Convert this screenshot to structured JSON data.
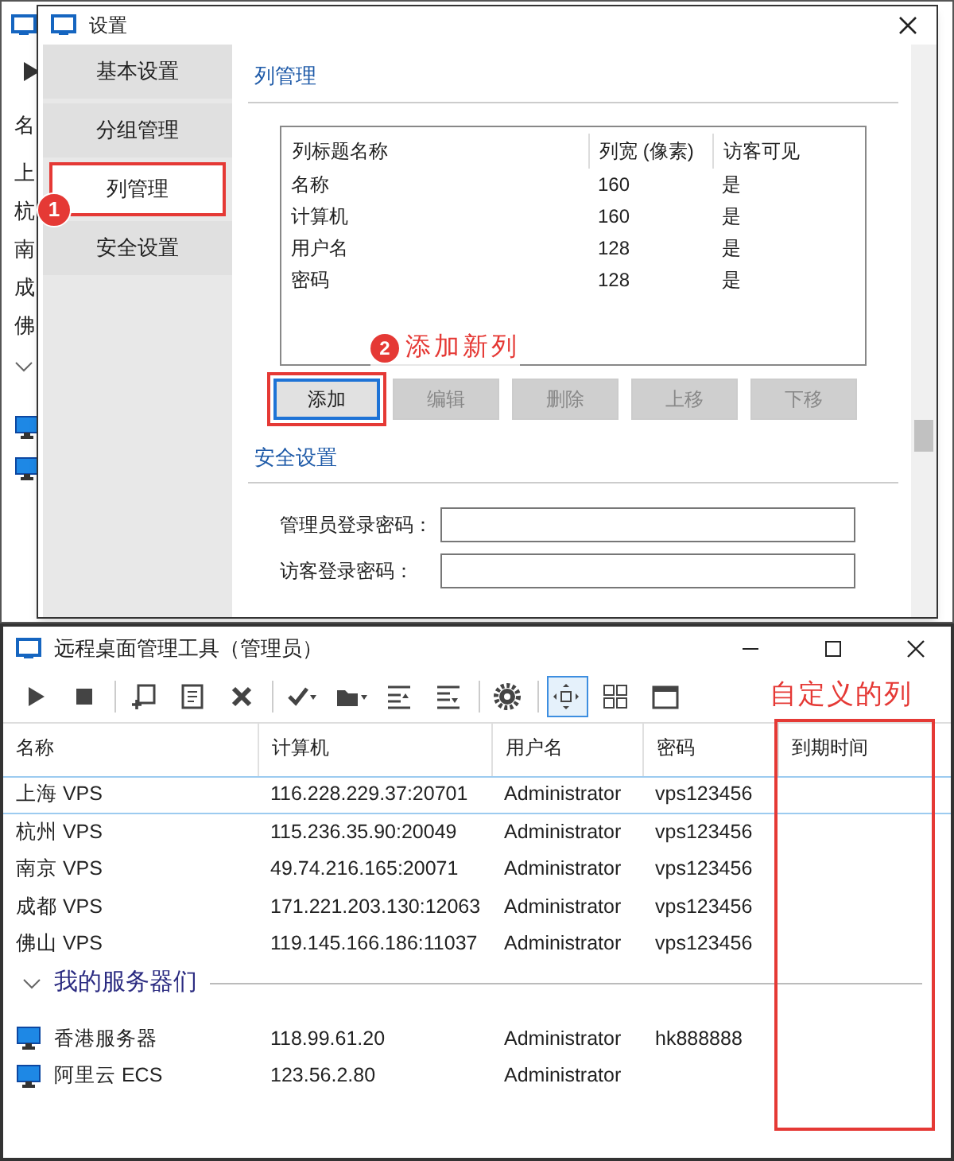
{
  "background_window": {
    "column_header": "名",
    "row_labels": [
      "上",
      "杭",
      "南",
      "成",
      "佛"
    ]
  },
  "settings_dialog": {
    "title": "设置",
    "nav": [
      {
        "label": "基本设置",
        "selected": false
      },
      {
        "label": "分组管理",
        "selected": false
      },
      {
        "label": "列管理",
        "selected": true
      },
      {
        "label": "安全设置",
        "selected": false
      }
    ],
    "column_section": {
      "title": "列管理",
      "columns": [
        "列标题名称",
        "列宽 (像素)",
        "访客可见"
      ],
      "rows": [
        [
          "名称",
          "160",
          "是"
        ],
        [
          "计算机",
          "160",
          "是"
        ],
        [
          "用户名",
          "128",
          "是"
        ],
        [
          "密码",
          "128",
          "是"
        ]
      ]
    },
    "buttons": [
      {
        "label": "添加",
        "disabled": false
      },
      {
        "label": "编辑",
        "disabled": true
      },
      {
        "label": "删除",
        "disabled": true
      },
      {
        "label": "上移",
        "disabled": true
      },
      {
        "label": "下移",
        "disabled": true
      }
    ],
    "security_section": {
      "title": "安全设置",
      "fields": [
        {
          "label": "管理员登录密码："
        },
        {
          "label": "访客登录密码："
        }
      ]
    }
  },
  "annotations": [
    {
      "number": "1"
    },
    {
      "number": "2",
      "text": "添加新列"
    },
    {
      "text": "自定义的列"
    }
  ],
  "main_window": {
    "title": "远程桌面管理工具（管理员）",
    "toolbar": [
      {
        "kind": "play",
        "selected": false
      },
      {
        "kind": "stop",
        "selected": false
      },
      {
        "kind": "add",
        "selected": false
      },
      {
        "kind": "doc",
        "selected": false
      },
      {
        "kind": "delete",
        "selected": false
      },
      {
        "kind": "check",
        "selected": false
      },
      {
        "kind": "folder",
        "selected": false
      },
      {
        "kind": "up",
        "selected": false
      },
      {
        "kind": "down",
        "selected": false
      },
      {
        "kind": "gear",
        "selected": false
      },
      {
        "kind": "fit",
        "selected": true
      },
      {
        "kind": "grid",
        "selected": false
      },
      {
        "kind": "window",
        "selected": false
      }
    ],
    "columns": [
      "名称",
      "计算机",
      "用户名",
      "密码",
      "到期时间"
    ],
    "rows": [
      {
        "cells": [
          "上海 VPS",
          "116.228.229.37:20701",
          "Administrator",
          "vps123456"
        ],
        "selected": true
      },
      {
        "cells": [
          "杭州 VPS",
          "115.236.35.90:20049",
          "Administrator",
          "vps123456"
        ],
        "selected": false
      },
      {
        "cells": [
          "南京 VPS",
          "49.74.216.165:20071",
          "Administrator",
          "vps123456"
        ],
        "selected": false
      },
      {
        "cells": [
          "成都 VPS",
          "171.221.203.130:12063",
          "Administrator",
          "vps123456"
        ],
        "selected": false
      },
      {
        "cells": [
          "佛山 VPS",
          "119.145.166.186:11037",
          "Administrator",
          "vps123456"
        ],
        "selected": false
      }
    ],
    "group": {
      "title": "我的服务器们",
      "expanded": true,
      "rows": [
        {
          "cells": [
            "香港服务器",
            "118.99.61.20",
            "Administrator",
            "hk888888"
          ],
          "selected": false
        },
        {
          "cells": [
            "阿里云 ECS",
            "123.56.2.80",
            "Administrator"
          ],
          "selected": false
        }
      ]
    }
  }
}
